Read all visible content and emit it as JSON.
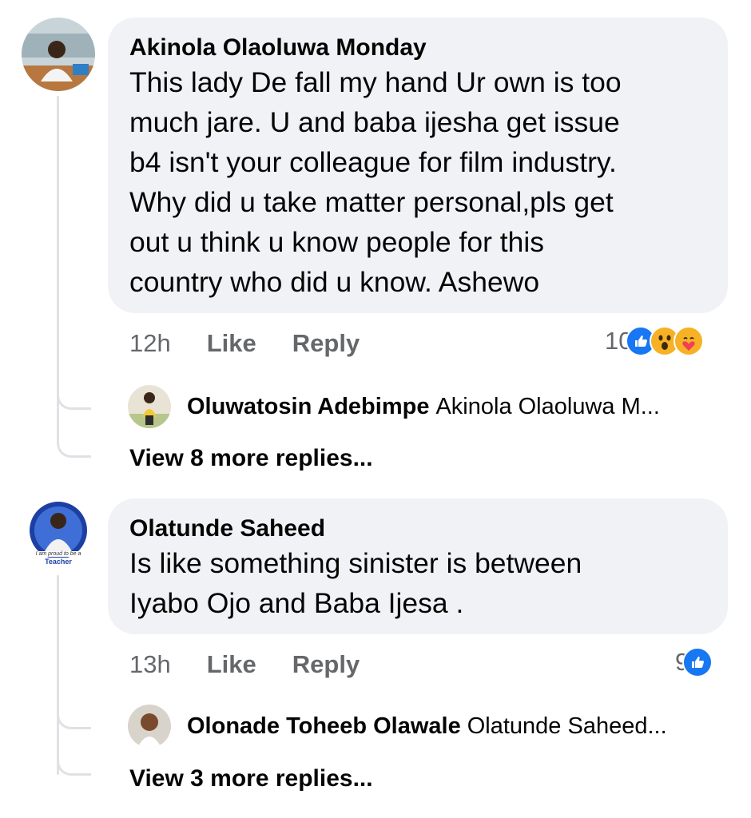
{
  "comments": [
    {
      "author": "Akinola Olaoluwa Monday",
      "text": "This lady De fall my hand Ur own is too\nmuch jare. U and baba ijesha get issue\nb4 isn't your colleague for film industry.\nWhy did u take matter personal,pls get\nout u think u know people for this\ncountry who did u know. Ashewo",
      "time": "12h",
      "like_label": "Like",
      "reply_label": "Reply",
      "reaction_count": "10",
      "reactions": [
        "like-icon",
        "wow-icon",
        "care-icon"
      ],
      "reply_preview": {
        "author": "Oluwatosin Adebimpe",
        "text": "Akinola Olaoluwa M..."
      },
      "view_more": "View 8 more replies..."
    },
    {
      "author": "Olatunde Saheed",
      "text": "Is like something sinister is between\nIyabo Ojo and Baba Ijesa .",
      "avatar_caption_top": "I am proud to be a",
      "avatar_caption_bottom": "Teacher",
      "time": "13h",
      "like_label": "Like",
      "reply_label": "Reply",
      "reaction_count": "9",
      "reactions": [
        "like-icon"
      ],
      "reply_preview": {
        "author": "Olonade Toheeb Olawale",
        "text": "Olatunde Saheed..."
      },
      "view_more": "View 3 more replies..."
    }
  ],
  "colors": {
    "bubble": "#f0f2f5",
    "like_blue": "#1877f2",
    "meta_gray": "#65676b"
  }
}
